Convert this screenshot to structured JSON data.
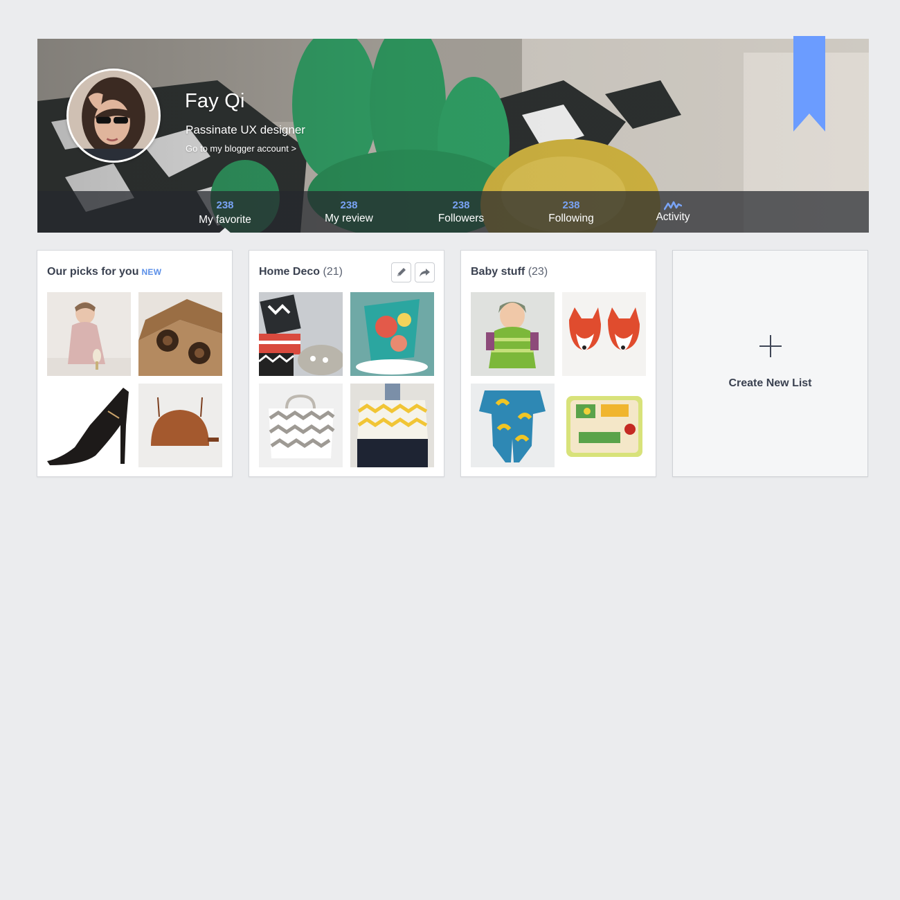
{
  "colors": {
    "accent": "#6b9cff",
    "page_bg": "#ebecee",
    "stat_count": "#79a3f5"
  },
  "profile": {
    "name": "Fay Qi",
    "tagline": "Passinate UX designer",
    "blog_link": "Go to my blogger account >"
  },
  "stats": [
    {
      "count": "238",
      "label": "My favorite",
      "active": true
    },
    {
      "count": "238",
      "label": "My review"
    },
    {
      "count": "238",
      "label": "Followers"
    },
    {
      "count": "238",
      "label": "Following"
    },
    {
      "icon": "activity-icon",
      "label": "Activity"
    }
  ],
  "lists": [
    {
      "title": "Our picks for you",
      "badge": "NEW",
      "items": [
        "girl-in-pink-dress",
        "wooden-toy-car",
        "black-high-heel",
        "brown-leather-bag"
      ]
    },
    {
      "title": "Home Deco",
      "count": "(21)",
      "tools": [
        "pencil-icon",
        "share-arrow-icon"
      ],
      "items": [
        "patterned-poufs",
        "floral-flower-pots",
        "chevron-storage-basket",
        "yellow-chevron-tote"
      ]
    },
    {
      "title": "Baby stuff",
      "count": "(23)",
      "items": [
        "knitted-baby-doll",
        "fox-baby-shoes",
        "banana-romper",
        "crocodile-puzzle"
      ]
    }
  ],
  "create_list": {
    "label": "Create New List",
    "icon": "plus-icon"
  }
}
